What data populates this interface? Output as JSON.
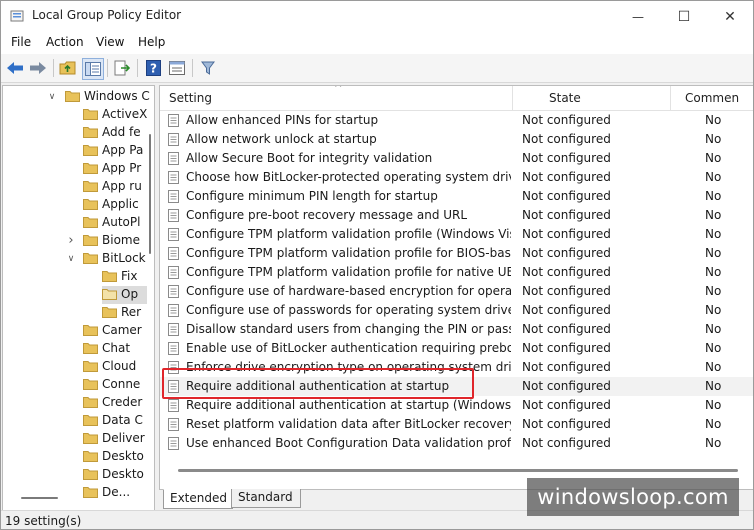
{
  "window": {
    "title": "Local Group Policy Editor",
    "minimize_glyph": "—",
    "maximize_glyph": "☐",
    "close_glyph": "✕"
  },
  "menu": [
    "File",
    "Action",
    "View",
    "Help"
  ],
  "toolbar": {
    "icons": [
      "back-arrow-icon",
      "forward-arrow-icon",
      "up-folder-icon",
      "show-hide-tree-icon",
      "export-list-icon",
      "help-icon",
      "properties-icon",
      "filter-icon"
    ]
  },
  "tree": {
    "nodes": [
      {
        "label": "Windows C",
        "expander": "expanded"
      },
      {
        "label": "ActiveX"
      },
      {
        "label": "Add fe"
      },
      {
        "label": "App Pa"
      },
      {
        "label": "App Pr"
      },
      {
        "label": "App ru"
      },
      {
        "label": "Applic"
      },
      {
        "label": "AutoPl"
      },
      {
        "label": "Biome",
        "expander": "collapsed"
      },
      {
        "label": "BitLock",
        "expander": "expanded"
      },
      {
        "label": "Fix"
      },
      {
        "label": "Op",
        "selected": true
      },
      {
        "label": "Rer"
      },
      {
        "label": "Camer"
      },
      {
        "label": "Chat"
      },
      {
        "label": "Cloud"
      },
      {
        "label": "Conne"
      },
      {
        "label": "Creder"
      },
      {
        "label": "Data C"
      },
      {
        "label": "Deliver"
      },
      {
        "label": "Deskto"
      },
      {
        "label": "Deskto"
      },
      {
        "label": "De..."
      }
    ]
  },
  "details": {
    "columns": {
      "setting": "Setting",
      "state": "State",
      "comment": "Commen"
    },
    "sort_glyph": "^",
    "rows": [
      {
        "setting": "Allow enhanced PINs for startup",
        "state": "Not configured",
        "comment": "No"
      },
      {
        "setting": "Allow network unlock at startup",
        "state": "Not configured",
        "comment": "No"
      },
      {
        "setting": "Allow Secure Boot for integrity validation",
        "state": "Not configured",
        "comment": "No"
      },
      {
        "setting": "Choose how BitLocker-protected operating system drives ca...",
        "state": "Not configured",
        "comment": "No"
      },
      {
        "setting": "Configure minimum PIN length for startup",
        "state": "Not configured",
        "comment": "No"
      },
      {
        "setting": "Configure pre-boot recovery message and URL",
        "state": "Not configured",
        "comment": "No"
      },
      {
        "setting": "Configure TPM platform validation profile (Windows Vista, ...",
        "state": "Not configured",
        "comment": "No"
      },
      {
        "setting": "Configure TPM platform validation profile for BIOS-based fir...",
        "state": "Not configured",
        "comment": "No"
      },
      {
        "setting": "Configure TPM platform validation profile for native UEFI fir...",
        "state": "Not configured",
        "comment": "No"
      },
      {
        "setting": "Configure use of hardware-based encryption for operating s...",
        "state": "Not configured",
        "comment": "No"
      },
      {
        "setting": "Configure use of passwords for operating system drives",
        "state": "Not configured",
        "comment": "No"
      },
      {
        "setting": "Disallow standard users from changing the PIN or password",
        "state": "Not configured",
        "comment": "No"
      },
      {
        "setting": "Enable use of BitLocker authentication requiring preboot ke...",
        "state": "Not configured",
        "comment": "No"
      },
      {
        "setting": "Enforce drive encryption type on operating system drives",
        "state": "Not configured",
        "comment": "No"
      },
      {
        "setting": "Require additional authentication at startup",
        "state": "Not configured",
        "comment": "No",
        "highlighted": true
      },
      {
        "setting": "Require additional authentication at startup (Windows Serve...",
        "state": "Not configured",
        "comment": "No"
      },
      {
        "setting": "Reset platform validation data after BitLocker recovery",
        "state": "Not configured",
        "comment": "No"
      },
      {
        "setting": "Use enhanced Boot Configuration Data validation profile",
        "state": "Not configured",
        "comment": "No"
      }
    ]
  },
  "tabs": [
    "Extended",
    "Standard"
  ],
  "status": "19 setting(s)",
  "watermark": "windowsloop.com",
  "colors": {
    "highlight_box": "#e0262b",
    "folder": "#e8c25a",
    "toolbar_blue": "#2f6fc7"
  }
}
